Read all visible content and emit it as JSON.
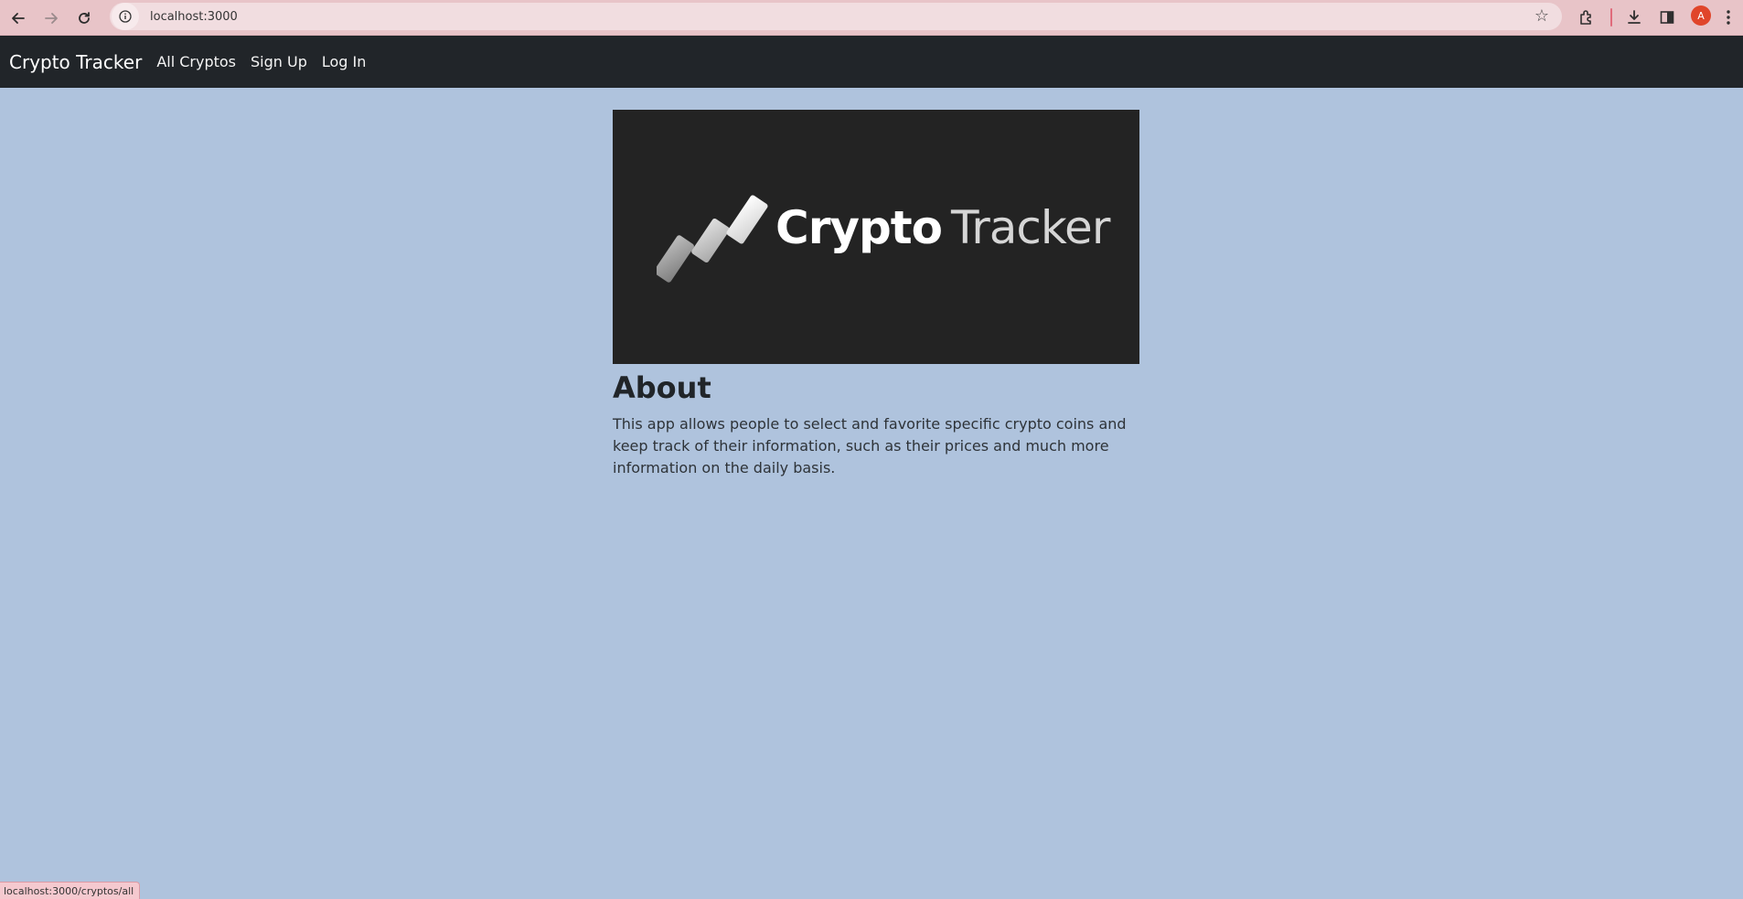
{
  "browser": {
    "url": "localhost:3000",
    "profile_initial": "A",
    "status_url": "localhost:3000/cryptos/all"
  },
  "navbar": {
    "brand": "Crypto Tracker",
    "links": [
      "All Cryptos",
      "Sign Up",
      "Log In"
    ],
    "background": "#212529"
  },
  "hero": {
    "logo_word1": "Crypto",
    "logo_word2": "Tracker",
    "background": "#232323"
  },
  "about": {
    "title": "About",
    "text": "This app allows people to select and favorite specific crypto coins and keep track of their information, such as their prices and much more information on the daily basis."
  },
  "colors": {
    "page_background": "#afc3dd",
    "chrome_background": "#e8c4c8"
  }
}
